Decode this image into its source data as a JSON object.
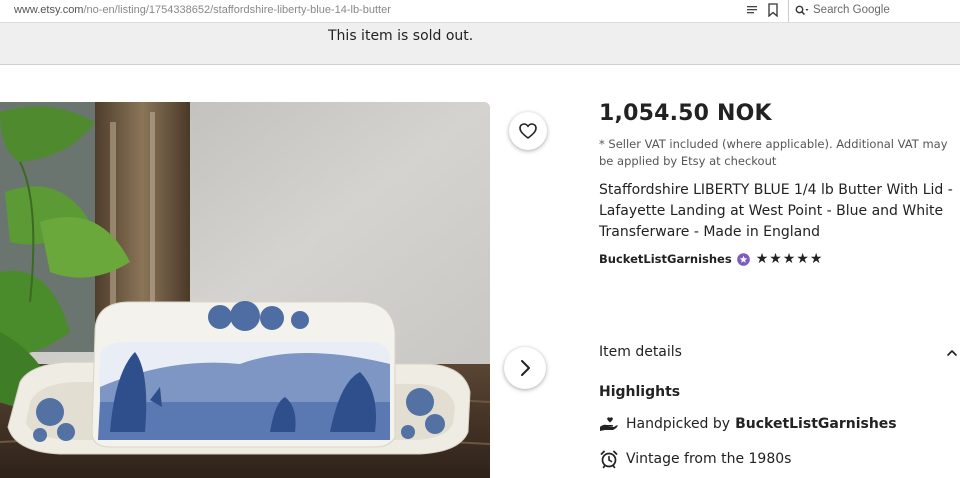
{
  "browser": {
    "url_host": "www.etsy.com",
    "url_path": "/no-en/listing/1754338652/staffordshire-liberty-blue-14-lb-butter",
    "search_placeholder": "Search Google"
  },
  "banner": {
    "sold_out_text": "This item is sold out."
  },
  "listing": {
    "price": "1,054.50 NOK",
    "vat_note": "* Seller VAT included (where applicable). Additional VAT may be applied by Etsy at checkout",
    "title": "Staffordshire LIBERTY BLUE 1/4 lb Butter With Lid - Lafayette Landing at West Point - Blue and White Transferware - Made in England",
    "shop_name": "BucketListGarnishes",
    "rating_stars": "★★★★★",
    "rating_value": 5
  },
  "details": {
    "section_label": "Item details",
    "highlights_label": "Highlights",
    "handpicked_prefix": "Handpicked by",
    "handpicked_shop": "BucketListGarnishes",
    "vintage_text": "Vintage from the 1980s"
  },
  "icons": {
    "favorite": "heart-icon",
    "next": "chevron-right-icon",
    "collapse": "chevron-up-icon",
    "handpicked": "hand-icon",
    "vintage": "alarm-clock-icon",
    "star_seller": "star-seller-badge-icon"
  },
  "colors": {
    "badge": "#7c5cc4",
    "banner_bg": "#efefef",
    "text": "#222222"
  }
}
